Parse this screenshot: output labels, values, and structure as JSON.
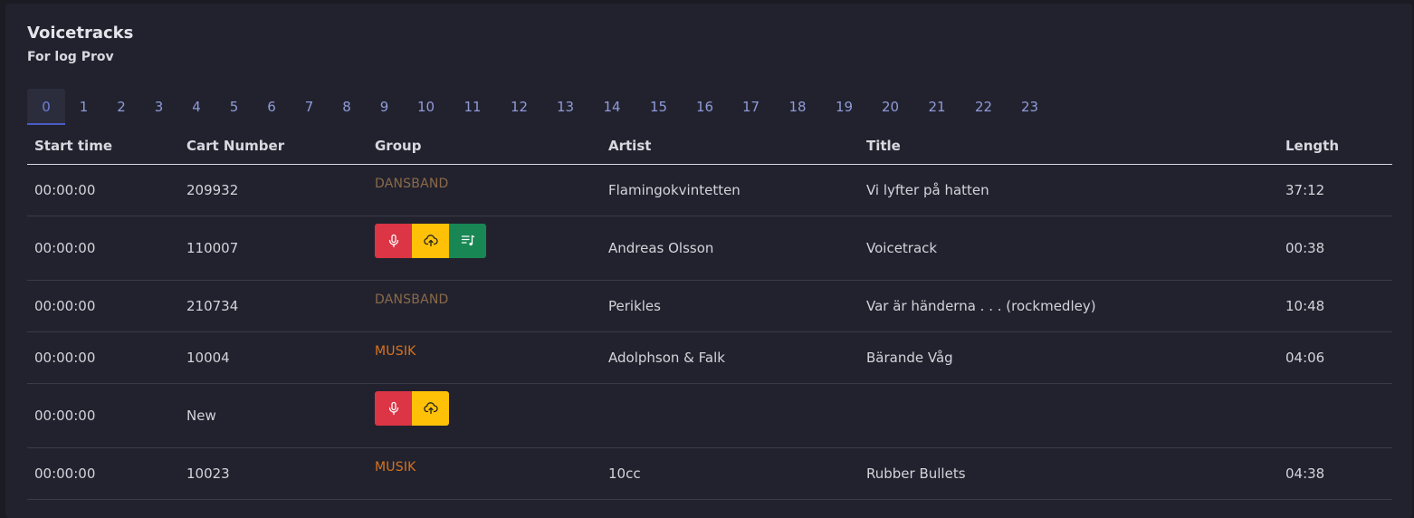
{
  "card": {
    "title": "Voicetracks",
    "subtitle": "For log Prov"
  },
  "tabs": [
    "0",
    "1",
    "2",
    "3",
    "4",
    "5",
    "6",
    "7",
    "8",
    "9",
    "10",
    "11",
    "12",
    "13",
    "14",
    "15",
    "16",
    "17",
    "18",
    "19",
    "20",
    "21",
    "22",
    "23"
  ],
  "active_tab": "0",
  "table": {
    "headers": {
      "start_time": "Start time",
      "cart_number": "Cart Number",
      "group": "Group",
      "artist": "Artist",
      "title": "Title",
      "length": "Length"
    },
    "rows": [
      {
        "start_time": "00:00:00",
        "cart_number": "209932",
        "group": "DANSBAND",
        "artist": "Flamingokvintetten",
        "title": "Vi lyfter på hatten",
        "length": "37:12"
      },
      {
        "start_time": "00:00:00",
        "cart_number": "110007",
        "group": "",
        "artist": "Andreas Olsson",
        "title": "Voicetrack",
        "length": "00:38"
      },
      {
        "start_time": "00:00:00",
        "cart_number": "210734",
        "group": "DANSBAND",
        "artist": "Perikles",
        "title": "Var är händerna . . . (rockmedley)",
        "length": "10:48"
      },
      {
        "start_time": "00:00:00",
        "cart_number": "10004",
        "group": "MUSIK",
        "artist": "Adolphson & Falk",
        "title": "Bärande Våg",
        "length": "04:06"
      },
      {
        "start_time": "00:00:00",
        "cart_number": "New",
        "group": "",
        "artist": "",
        "title": "",
        "length": ""
      },
      {
        "start_time": "00:00:00",
        "cart_number": "10023",
        "group": "MUSIK",
        "artist": "10cc",
        "title": "Rubber Bullets",
        "length": "04:38"
      }
    ]
  },
  "icons": {
    "record": "microphone-icon",
    "upload": "cloud-upload-icon",
    "playlist": "playlist-music-icon"
  },
  "colors": {
    "background": "#1b1b24",
    "card": "#22222e",
    "tab_text": "#8f9bd9",
    "tab_active_border": "#4a5bc8",
    "group_dansband": "#8a6a4a",
    "group_musik": "#d9731f",
    "record_button": "#dc3545",
    "upload_button": "#ffc107",
    "playlist_button": "#198754"
  }
}
